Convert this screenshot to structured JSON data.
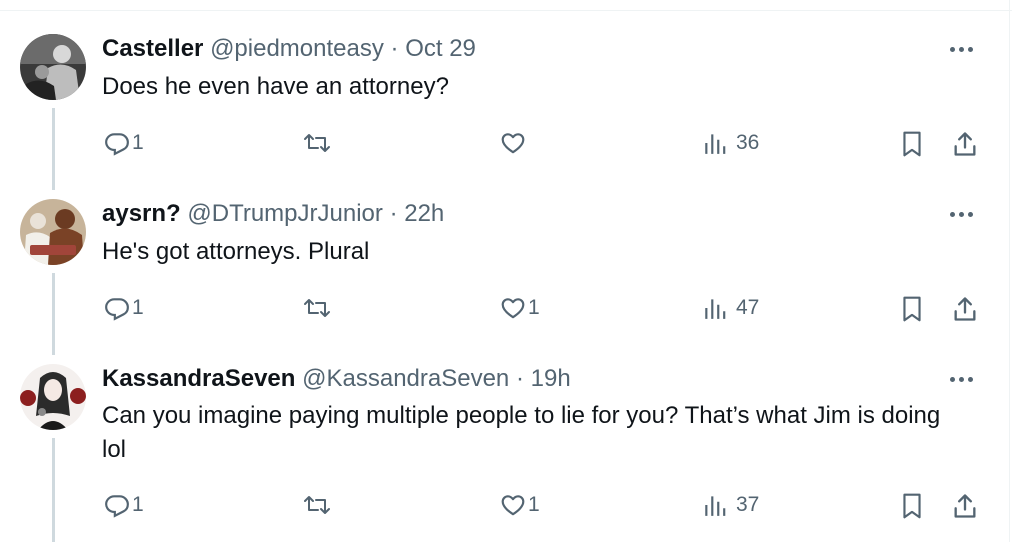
{
  "tweets": [
    {
      "name": "Casteller",
      "handle": "@piedmonteasy",
      "separator": "·",
      "time": "Oct 29",
      "text": "Does he even have an attorney?",
      "replies": "1",
      "retweets": "",
      "likes": "",
      "views": "36",
      "avatar": "photo-avatar"
    },
    {
      "name": "aysrn?",
      "handle": "@DTrumpJrJunior",
      "separator": "·",
      "time": "22h",
      "text": "He's got attorneys. Plural",
      "replies": "1",
      "retweets": "",
      "likes": "1",
      "views": "47",
      "avatar": "photo-avatar"
    },
    {
      "name": "KassandraSeven",
      "handle": "@KassandraSeven",
      "separator": "·",
      "time": "19h",
      "text": "Can you imagine paying multiple people to lie for you? That’s what Jim is doing lol",
      "replies": "1",
      "retweets": "",
      "likes": "1",
      "views": "37",
      "avatar": "illustration-avatar"
    }
  ],
  "colors": {
    "text": "#0f1419",
    "secondary": "#536471",
    "thread_line": "#cfd9de",
    "border": "#eff3f4"
  },
  "icons": [
    "reply-icon",
    "retweet-icon",
    "like-icon",
    "views-icon",
    "bookmark-icon",
    "share-icon",
    "more-icon"
  ]
}
